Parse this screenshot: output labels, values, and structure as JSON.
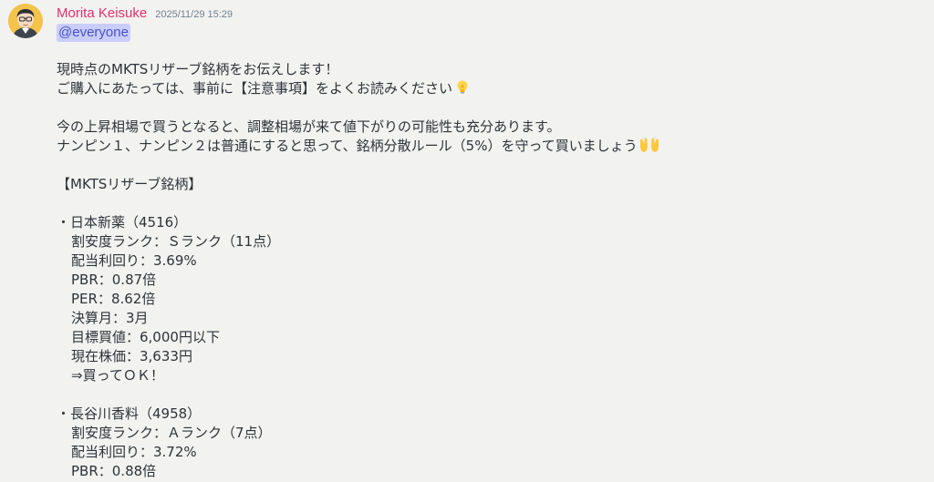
{
  "message": {
    "author": "Morita Keisuke",
    "timestamp": "2025/11/29 15:29",
    "mention": "@everyone",
    "author_color": "#e0306e",
    "mention_bg": "#c9cdfb",
    "mention_fg": "#4752c4"
  },
  "content": {
    "intro_1": "現時点のMKTSリザーブ銘柄をお伝えします！",
    "intro_2": "ご購入にあたっては、事前に【注意事項】をよくお読みください",
    "intro_2_emoji": "light-bulb-icon",
    "para_1": "今の上昇相場で買うとなると、調整相場が来て値下がりの可能性も充分あります。",
    "para_2": "ナンピン１、ナンピン２は普通にすると思って、銘柄分散ルール（5%）を守って買いましょう",
    "para_2_emoji": "raising-hands-icon",
    "section_title": "【MKTSリザーブ銘柄】",
    "stocks": [
      {
        "name": "・日本新薬（4516）",
        "rank": "割安度ランク：Ｓランク（11点）",
        "dividend": "配当利回り：3.69%",
        "pbr": "PBR：0.87倍",
        "per": "PER：8.62倍",
        "settlement": "決算月：3月",
        "target": "目標買値：6,000円以下",
        "price": "現在株価：3,633円",
        "verdict": "⇒買ってＯＫ！"
      },
      {
        "name": "・長谷川香料（4958）",
        "rank": "割安度ランク：Ａランク（7点）",
        "dividend": "配当利回り：3.72%",
        "pbr": "PBR：0.88倍"
      }
    ]
  }
}
